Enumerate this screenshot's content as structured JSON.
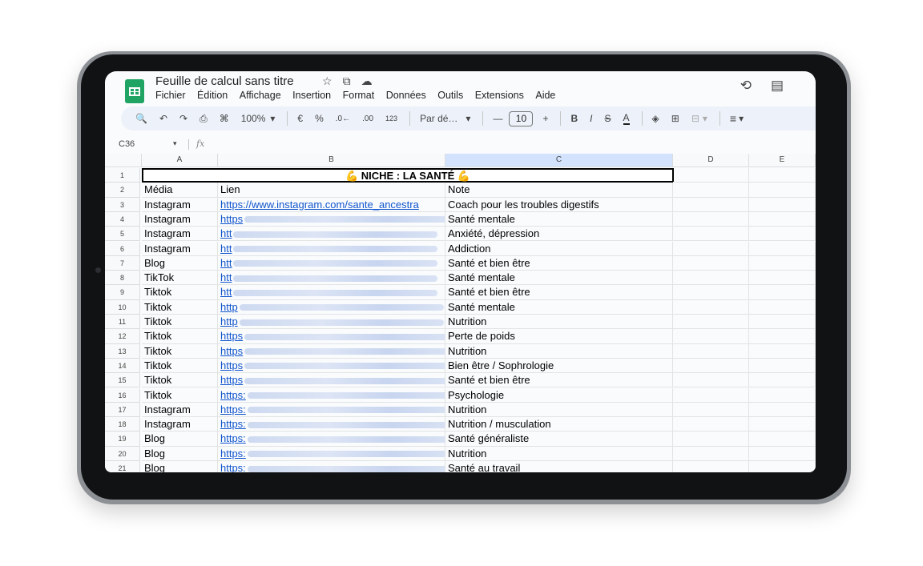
{
  "app": {
    "doc_title": "Feuille de calcul sans titre",
    "title_icons": [
      "☆",
      "⧉",
      "☁"
    ],
    "menu": [
      "Fichier",
      "Édition",
      "Affichage",
      "Insertion",
      "Format",
      "Données",
      "Outils",
      "Extensions",
      "Aide"
    ],
    "header_icons": [
      "⟲",
      "▤"
    ]
  },
  "toolbar": {
    "search": "🔍",
    "undo": "↶",
    "redo": "↷",
    "print": "⎙",
    "paint": "⌘",
    "zoom": "100%",
    "zoom_caret": "▾",
    "currency": "€",
    "percent": "%",
    "dec_minus": ".0←",
    "dec_plus": ".00",
    "num123": "123",
    "font": "Par dé…",
    "font_caret": "▾",
    "minus": "—",
    "font_size": "10",
    "plus": "+",
    "bold": "B",
    "italic": "I",
    "strike": "S",
    "text_color": "A",
    "fill": "◈",
    "borders": "⊞",
    "merge": "⊟",
    "merge_caret": "▾",
    "align": "≡",
    "align_caret": "▾"
  },
  "formula_bar": {
    "cell_ref": "C36",
    "caret": "▾",
    "fx": "fx",
    "content": ""
  },
  "columns": [
    "A",
    "B",
    "C",
    "D",
    "E"
  ],
  "selected_column": "C",
  "title_row": {
    "row_number": "1",
    "text": "💪 NICHE : LA SANTÉ 💪"
  },
  "header_row": {
    "row_number": "2",
    "a": "Média",
    "b": "Lien",
    "c": "Note"
  },
  "rows": [
    {
      "n": "3",
      "media": "Instagram",
      "link": "https://www.instagram.com/sante_ancestra",
      "note": "Coach pour les troubles digestifs"
    },
    {
      "n": "4",
      "media": "Instagram",
      "link": "https",
      "note": "Santé mentale"
    },
    {
      "n": "5",
      "media": "Instagram",
      "link": "htt",
      "note": "Anxiété, dépression"
    },
    {
      "n": "6",
      "media": "Instagram",
      "link": "htt",
      "note": "Addiction"
    },
    {
      "n": "7",
      "media": "Blog",
      "link": "htt",
      "note": "Santé et bien être"
    },
    {
      "n": "8",
      "media": "TikTok",
      "link": "htt",
      "note": "Santé mentale"
    },
    {
      "n": "9",
      "media": "Tiktok",
      "link": "htt",
      "note": "Santé et bien être"
    },
    {
      "n": "10",
      "media": "Tiktok",
      "link": "http",
      "note": "Santé mentale"
    },
    {
      "n": "11",
      "media": "Tiktok",
      "link": "http",
      "note": "Nutrition"
    },
    {
      "n": "12",
      "media": "Tiktok",
      "link": "https",
      "note": "Perte de poids"
    },
    {
      "n": "13",
      "media": "Tiktok",
      "link": "https",
      "note": "Nutrition"
    },
    {
      "n": "14",
      "media": "Tiktok",
      "link": "https",
      "note": "Bien être / Sophrologie"
    },
    {
      "n": "15",
      "media": "Tiktok",
      "link": "https",
      "note": "Santé et bien être"
    },
    {
      "n": "16",
      "media": "Tiktok",
      "link": "https:",
      "note": "Psychologie"
    },
    {
      "n": "17",
      "media": "Instagram",
      "link": "https:",
      "note": "Nutrition"
    },
    {
      "n": "18",
      "media": "Instagram",
      "link": "https:",
      "note": "Nutrition / musculation"
    },
    {
      "n": "19",
      "media": "Blog",
      "link": "https:",
      "note": "Santé généraliste"
    },
    {
      "n": "20",
      "media": "Blog",
      "link": "https:",
      "note": "Nutrition"
    },
    {
      "n": "21",
      "media": "Blog",
      "link": "https:",
      "note": "Santé au travail"
    }
  ],
  "colors": {
    "sheets_green": "#1fa463",
    "link": "#1155cc",
    "selected_header": "#d3e3fd",
    "toolbar_bg": "#edf2fa"
  }
}
